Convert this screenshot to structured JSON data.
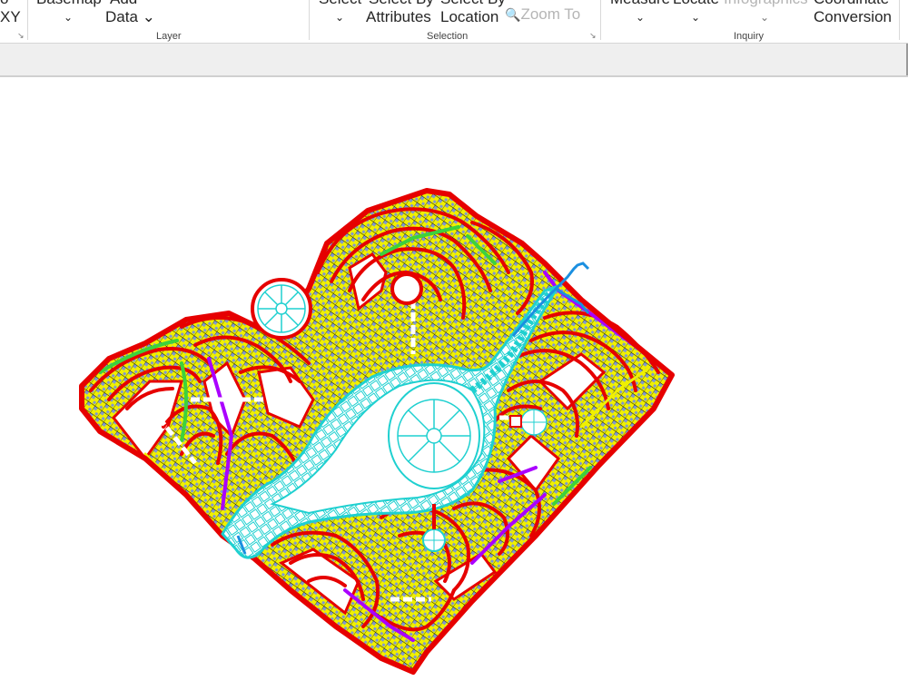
{
  "ribbon": {
    "groups": [
      {
        "name": "layer",
        "label": "Layer"
      },
      {
        "name": "selection",
        "label": "Selection"
      },
      {
        "name": "inquiry",
        "label": "Inquiry"
      }
    ],
    "buttons": {
      "go_to_xy": {
        "line1": "o",
        "line2": "XY"
      },
      "basemap": {
        "line1": "Basemap",
        "line2": "⌄"
      },
      "add_data": {
        "line1": "Add",
        "line2": "Data ⌄"
      },
      "select": {
        "line1": "Select",
        "line2": "⌄"
      },
      "select_by_attributes": {
        "line1": "Select By",
        "line2": "Attributes"
      },
      "select_by_location": {
        "line1": "Select By",
        "line2": "Location"
      },
      "zoom_to": {
        "label": "Zoom To"
      },
      "measure": {
        "line1": "Measure",
        "line2": "⌄"
      },
      "locate": {
        "line1": "Locate",
        "line2": "⌄"
      },
      "infographics": {
        "line1": "Infographics",
        "line2": "⌄"
      },
      "coordinate_conversion": {
        "line1": "Coordinate",
        "line2": "Conversion"
      }
    }
  },
  "map": {
    "layer_colors": {
      "boundary": "#e60000",
      "parcels_a": "#f0f000",
      "parcels_b": "#7f98d0",
      "green_roads": "#3cd23c",
      "purple_roads": "#aa00ff",
      "central_park": "#1fd0d0",
      "canal": "#1a8fe0",
      "paths": "#ffffff"
    }
  }
}
